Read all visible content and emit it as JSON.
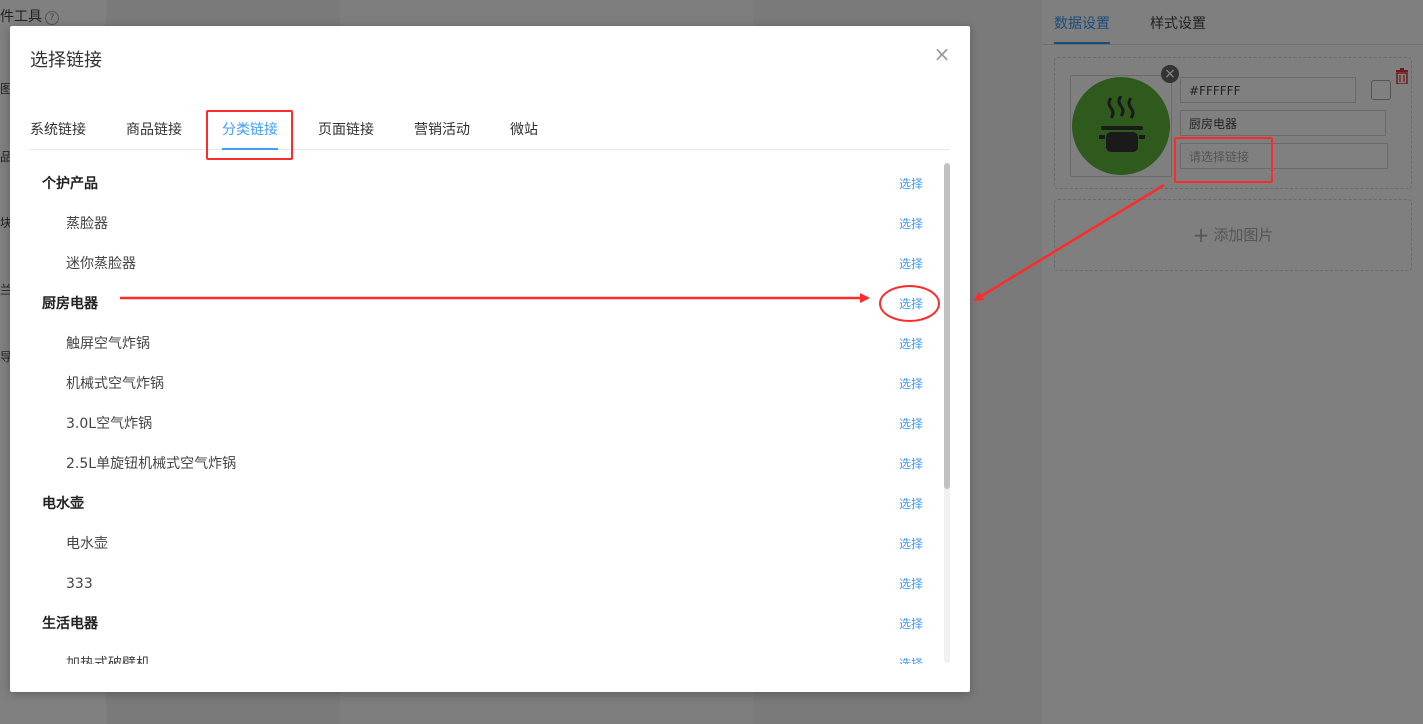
{
  "background": {
    "tool_title": "件工具",
    "fragments": [
      "图",
      "品",
      "块",
      "兰",
      "导"
    ]
  },
  "right_panel": {
    "tabs": [
      {
        "label": "数据设置",
        "active": true
      },
      {
        "label": "样式设置",
        "active": false
      }
    ],
    "color_value": "#FFFFFF",
    "title_value": "厨房电器",
    "link_placeholder": "请选择链接",
    "add_image_label": "添加图片",
    "thumb_color": "#4caf2a"
  },
  "modal": {
    "title": "选择链接",
    "close_glyph": "×",
    "tabs": [
      {
        "label": "系统链接",
        "active": false
      },
      {
        "label": "商品链接",
        "active": false
      },
      {
        "label": "分类链接",
        "active": true
      },
      {
        "label": "页面链接",
        "active": false
      },
      {
        "label": "营销活动",
        "active": false
      },
      {
        "label": "微站",
        "active": false
      }
    ],
    "select_label": "选择",
    "categories": [
      {
        "label": "个护产品",
        "level": "parent"
      },
      {
        "label": "蒸脸器",
        "level": "child"
      },
      {
        "label": "迷你蒸脸器",
        "level": "child"
      },
      {
        "label": "厨房电器",
        "level": "parent"
      },
      {
        "label": "触屏空气炸锅",
        "level": "child"
      },
      {
        "label": "机械式空气炸锅",
        "level": "child"
      },
      {
        "label": "3.0L空气炸锅",
        "level": "child"
      },
      {
        "label": "2.5L单旋钮机械式空气炸锅",
        "level": "child"
      },
      {
        "label": "电水壶",
        "level": "parent"
      },
      {
        "label": "电水壶",
        "level": "child"
      },
      {
        "label": "333",
        "level": "child"
      },
      {
        "label": "生活电器",
        "level": "parent"
      },
      {
        "label": "加热式破壁机",
        "level": "child"
      }
    ]
  },
  "colors": {
    "accent": "#409eff",
    "annotation": "#ff2a2a"
  }
}
